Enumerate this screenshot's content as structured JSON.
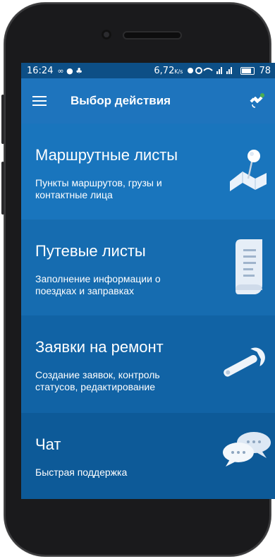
{
  "status_bar": {
    "time": "16:24",
    "indicators": "∞ ● ♣",
    "speed": "6,72",
    "speed_unit": "K/s",
    "battery": "78"
  },
  "toolbar": {
    "title": "Выбор действия",
    "menu_icon": "hamburger-menu-icon",
    "right_icon": "satellite-icon",
    "right_icon_status_color": "#4caf50"
  },
  "cards": [
    {
      "title": "Маршрутные листы",
      "description": "Пункты маршрутов, грузы и контактные лица",
      "icon": "map-pin-icon",
      "color": "#1975bd"
    },
    {
      "title": "Путевые листы",
      "description": "Заполнение информации о поездках и заправках",
      "icon": "scroll-document-icon",
      "color": "#166cb0"
    },
    {
      "title": "Заявки на ремонт",
      "description": "Создание заявок, контроль статусов, редактирование",
      "icon": "wrench-icon",
      "color": "#1163a5"
    },
    {
      "title": "Чат",
      "description": "Быстрая поддержка",
      "icon": "chat-bubbles-icon",
      "color": "#0d5a98"
    }
  ]
}
